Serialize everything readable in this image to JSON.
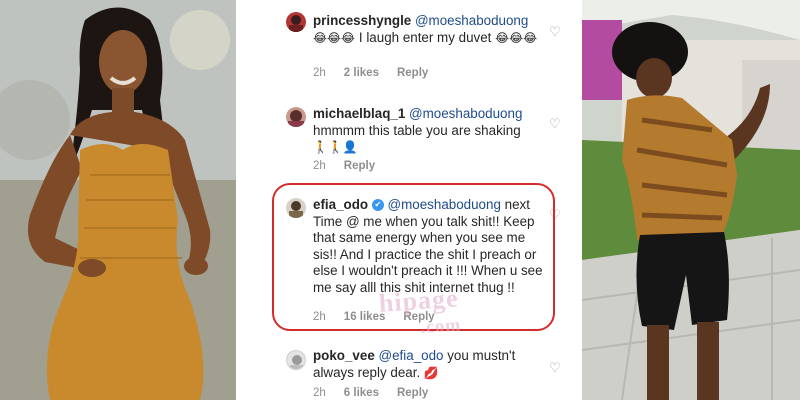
{
  "comments": [
    {
      "username": "princesshyngle",
      "mention": "@moeshaboduong",
      "text_emojis": "😂😂😂 ",
      "text": "I laugh enter my duvet",
      "text_emojis_end": "😂😂😂",
      "time": "2h",
      "likes": "2 likes",
      "reply": "Reply"
    },
    {
      "username": "michaelblaq_1",
      "mention": "@moeshaboduong",
      "text": "hmmmm this table you are shaking",
      "text_emojis_end": "🚶🚶👤",
      "time": "2h",
      "likes": "",
      "reply": "Reply"
    },
    {
      "username": "efia_odo",
      "verified": "✔",
      "mention": "@moeshaboduong",
      "text": "next Time @ me when you talk shit!! Keep that same energy when you see me sis!! And I practice the shit I preach or else I wouldn't preach it !!! When u see me say alll this shit internet thug !!",
      "time": "2h",
      "likes": "16 likes",
      "reply": "Reply"
    },
    {
      "username": "poko_vee",
      "mention": "@efia_odo",
      "text": "you mustn't always reply dear.",
      "text_emojis_end": "💋",
      "time": "2h",
      "likes": "6 likes",
      "reply": "Reply"
    }
  ],
  "heart_icon": "♡",
  "watermark": {
    "line1": "hipage",
    "line2": ".com"
  },
  "colors": {
    "highlight": "#d62b2b",
    "mention": "#1f4c8c",
    "meta": "#8e8e8e",
    "dress": "#c98a2e"
  }
}
